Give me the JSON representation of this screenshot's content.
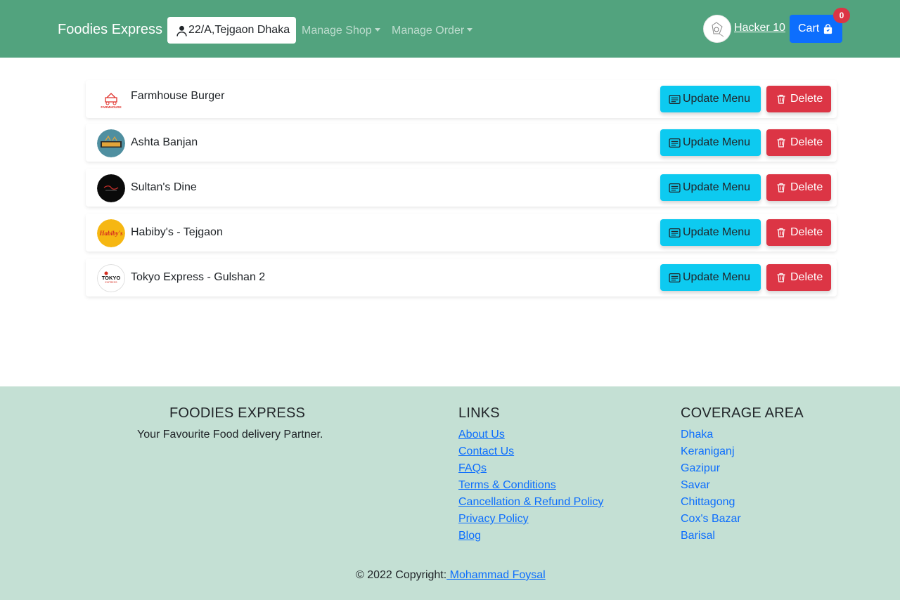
{
  "navbar": {
    "brand": "Foodies Express",
    "location": "22/A,Tejgaon Dhaka",
    "manage_shop": "Manage Shop",
    "manage_order": "Manage Order",
    "user_name": "Hacker 10",
    "cart_label": "Cart",
    "cart_count": "0"
  },
  "shops": [
    {
      "name": "Farmhouse Burger",
      "update_label": "Update Menu",
      "delete_label": "Delete"
    },
    {
      "name": "Ashta Banjan",
      "update_label": "Update Menu",
      "delete_label": "Delete"
    },
    {
      "name": "Sultan's Dine",
      "update_label": "Update Menu",
      "delete_label": "Delete"
    },
    {
      "name": "Habiby's - Tejgaon",
      "update_label": "Update Menu",
      "delete_label": "Delete"
    },
    {
      "name": "Tokyo Express - Gulshan 2",
      "update_label": "Update Menu",
      "delete_label": "Delete"
    }
  ],
  "logo_text": {
    "farmhouse": "FARMHOUSE",
    "habibys": "Habiby's",
    "tokyo": "TOKYO",
    "tokyo_sub": "EXPRESS"
  },
  "footer": {
    "brand_title": "FOODIES EXPRESS",
    "tagline": "Your Favourite Food delivery Partner.",
    "links_title": "LINKS",
    "links": [
      "About Us",
      "Contact Us",
      "FAQs",
      "Terms & Conditions",
      "Cancellation & Refund Policy",
      "Privacy Policy",
      "Blog"
    ],
    "coverage_title": "COVERAGE AREA",
    "coverage": [
      "Dhaka",
      "Keraniganj",
      "Gazipur",
      "Savar",
      "Chittagong",
      "Cox's Bazar",
      "Barisal"
    ],
    "copyright_prefix": "© 2022 Copyright:",
    "copyright_name": " Mohammad Foysal"
  },
  "colors": {
    "navbar_bg": "#52a37e",
    "footer_bg": "#c4e0d4",
    "primary": "#0d6efd",
    "info": "#0dcaf0",
    "danger": "#dc3545"
  },
  "icons": {
    "location": "person-pin-icon",
    "cart": "bag-icon",
    "update": "card-text-icon",
    "delete": "trash-icon"
  }
}
